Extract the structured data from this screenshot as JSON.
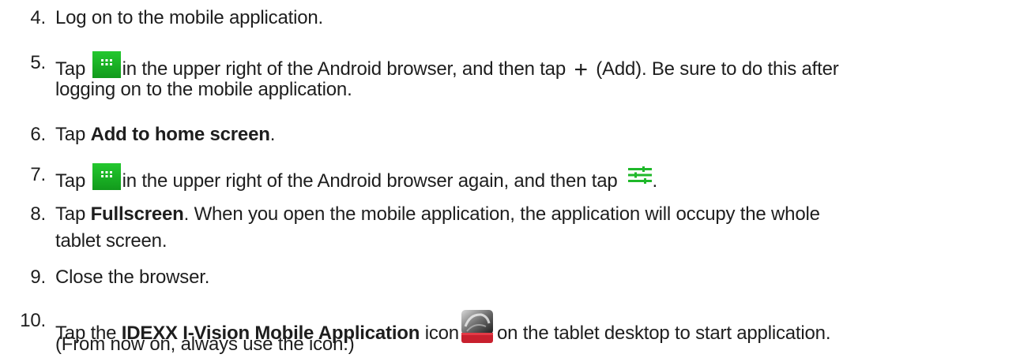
{
  "steps": [
    {
      "number": "4.",
      "text": "Log on to the mobile application."
    },
    {
      "number": "5.",
      "pre": "Tap",
      "icon": "green-grid-menu-icon",
      "mid": "in the upper right of the Android browser, and then tap",
      "plus_symbol": "+",
      "post": "(Add). Be sure to do this after",
      "line2": "logging on to the mobile application."
    },
    {
      "number": "6.",
      "pre": "Tap ",
      "bold": "Add to home screen",
      "post": "."
    },
    {
      "number": "7.",
      "pre": "Tap",
      "icon": "green-grid-menu-icon",
      "mid": "in the upper right of the Android browser again, and then tap",
      "icon2": "green-sliders-icon",
      "post": "."
    },
    {
      "number": "8.",
      "pre": "Tap ",
      "bold": "Fullscreen",
      "post": ". When you open the mobile application, the application will occupy the whole",
      "line2": "tablet screen."
    },
    {
      "number": "9.",
      "text": "Close the browser."
    },
    {
      "number": "10.",
      "pre": "Tap the ",
      "bold": "IDEXX I-Vision Mobile Application",
      "mid": " icon",
      "icon": "x-ray-app-icon",
      "post": "on the tablet desktop to start application.",
      "line2": "(From now on, always use the icon.)"
    }
  ],
  "colors": {
    "text": "#1e1e1e",
    "icon_green": "#1fb82a"
  }
}
